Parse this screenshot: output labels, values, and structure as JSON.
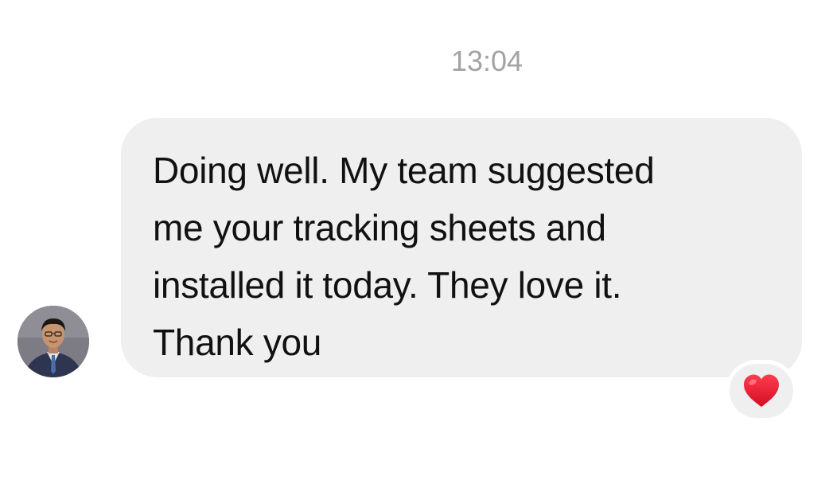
{
  "conversation": {
    "timestamp": "13:04",
    "messages": [
      {
        "text": "Doing well. My team suggested\nme your tracking sheets and\ninstalled it today. They love it.\nThank you",
        "reaction": "red-heart-icon"
      }
    ]
  },
  "colors": {
    "bubble": "#efefef",
    "timestamp": "#a3a3a3",
    "text": "#111111",
    "heart": "#e0132b"
  }
}
